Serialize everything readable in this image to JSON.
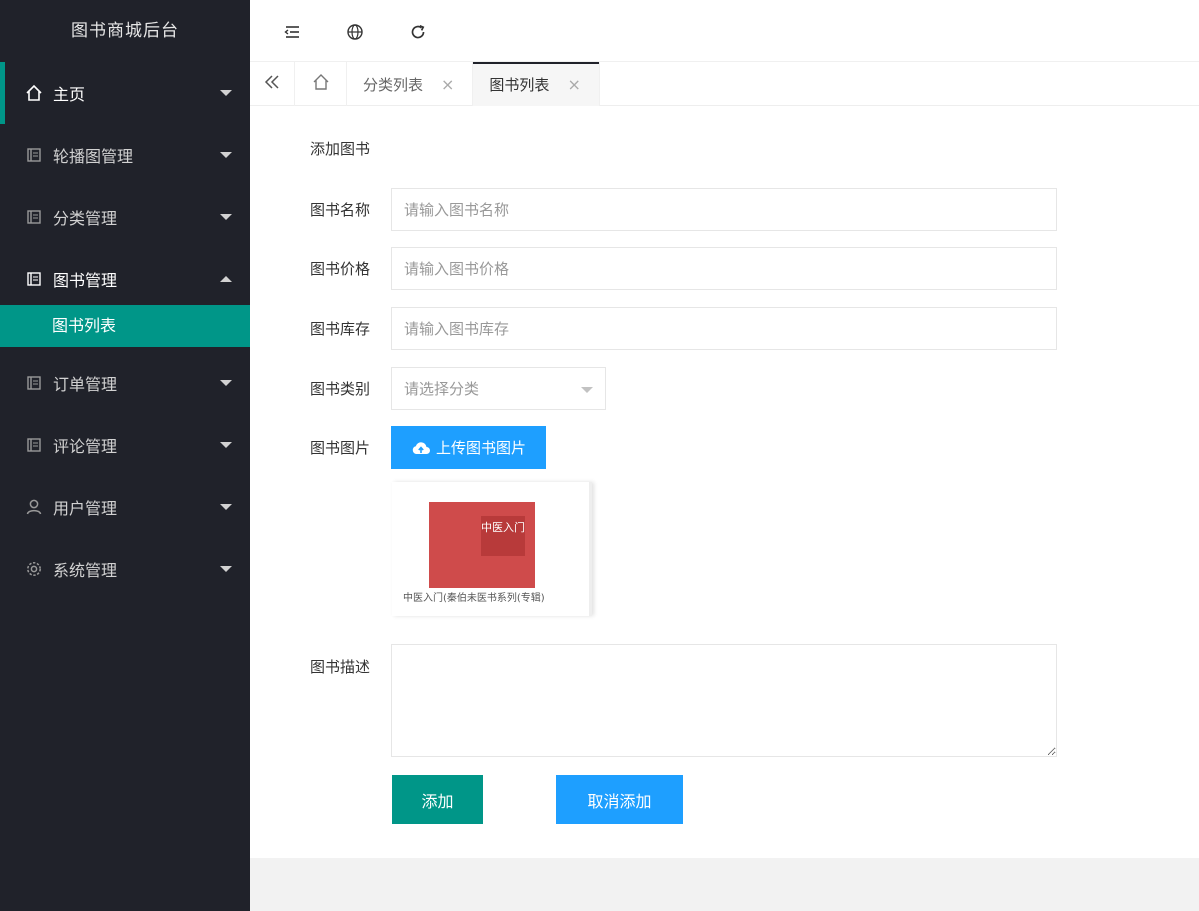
{
  "app": {
    "title": "图书商城后台"
  },
  "sidebar": {
    "items": [
      {
        "label": "主页",
        "icon": "home-icon"
      },
      {
        "label": "轮播图管理",
        "icon": "book-icon"
      },
      {
        "label": "分类管理",
        "icon": "book-icon"
      },
      {
        "label": "图书管理",
        "icon": "book-icon",
        "sub": [
          {
            "label": "图书列表"
          }
        ]
      },
      {
        "label": "订单管理",
        "icon": "book-icon"
      },
      {
        "label": "评论管理",
        "icon": "book-icon"
      },
      {
        "label": "用户管理",
        "icon": "user-icon"
      },
      {
        "label": "系统管理",
        "icon": "gear-icon"
      }
    ]
  },
  "tabs": [
    {
      "label": "分类列表",
      "close": "×"
    },
    {
      "label": "图书列表",
      "close": "×"
    }
  ],
  "form": {
    "title": "添加图书",
    "name": {
      "label": "图书名称",
      "placeholder": "请输入图书名称"
    },
    "price": {
      "label": "图书价格",
      "placeholder": "请输入图书价格"
    },
    "stock": {
      "label": "图书库存",
      "placeholder": "请输入图书库存"
    },
    "category": {
      "label": "图书类别",
      "placeholder": "请选择分类"
    },
    "image": {
      "label": "图书图片",
      "upload_label": "上传图书图片",
      "preview_caption": "中医入门(秦伯未医书系列(专辑)",
      "cover_title": "中医入门"
    },
    "description": {
      "label": "图书描述"
    },
    "add_label": "添加",
    "cancel_label": "取消添加"
  },
  "colors": {
    "sidebar_bg": "#20222a",
    "accent": "#009688",
    "primary": "#1e9fff"
  }
}
